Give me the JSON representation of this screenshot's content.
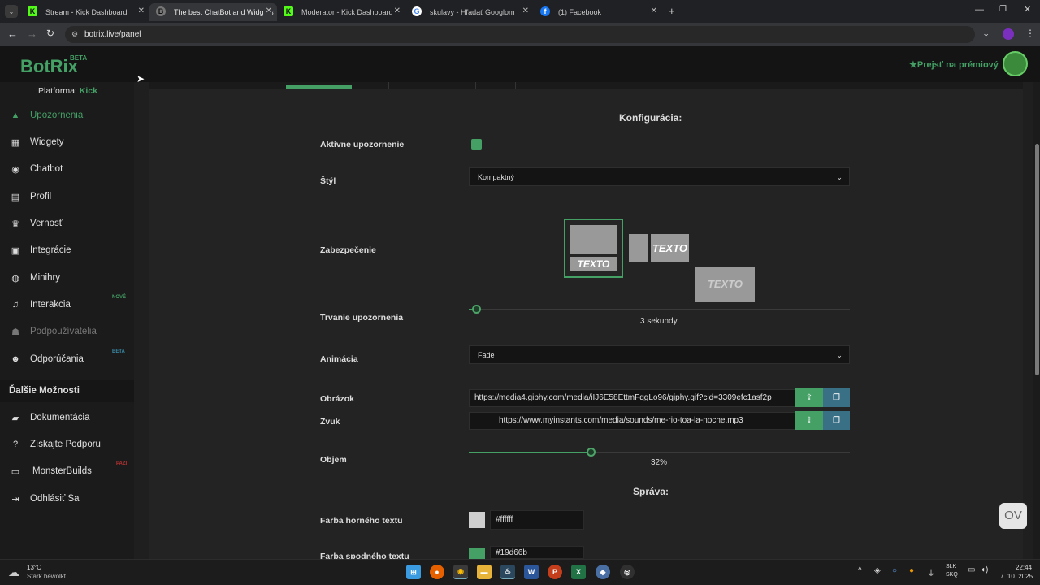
{
  "browser": {
    "tabs": [
      {
        "title": "Stream - Kick Dashboard",
        "favicon": "K"
      },
      {
        "title": "The best ChatBot and Widgets",
        "favicon": "B"
      },
      {
        "title": "Moderator - Kick Dashboard",
        "favicon": "K"
      },
      {
        "title": "skulavy - Hľadať Googlom",
        "favicon": "G"
      },
      {
        "title": "(1) Facebook",
        "favicon": "f"
      }
    ],
    "url": "botrix.live/panel"
  },
  "app": {
    "logo": "BotRix",
    "logo_badge": "BETA",
    "platform_label": "Platforma:",
    "platform_value": "Kick",
    "premium_label": "Prejsť na prémiový",
    "accent_color": "#44a065"
  },
  "sidebar": {
    "items": [
      {
        "label": "Upozornenia",
        "icon": "warning-icon"
      },
      {
        "label": "Widgety",
        "icon": "grid-icon"
      },
      {
        "label": "Chatbot",
        "icon": "robot-icon"
      },
      {
        "label": "Profil",
        "icon": "id-card-icon"
      },
      {
        "label": "Vernosť",
        "icon": "trophy-icon"
      },
      {
        "label": "Integrácie",
        "icon": "plug-icon"
      },
      {
        "label": "Minihry",
        "icon": "gamepad-icon"
      },
      {
        "label": "Interakcia",
        "icon": "music-icon",
        "badge": "NOVÉ"
      },
      {
        "label": "Podpoužívatelia",
        "icon": "users-icon"
      },
      {
        "label": "Odporúčania",
        "icon": "group-icon",
        "badge": "BETA"
      }
    ],
    "more_header": "Ďalšie Možnosti",
    "more_items": [
      {
        "label": "Dokumentácia",
        "icon": "book-icon"
      },
      {
        "label": "Získajte Podporu",
        "icon": "help-icon"
      },
      {
        "label": "MonsterBuilds",
        "icon": "laptop-icon",
        "badge": "PAZI"
      },
      {
        "label": "Odhlásiť Sa",
        "icon": "logout-icon"
      }
    ]
  },
  "config": {
    "title": "Konfigurácia:",
    "active_label": "Aktívne upozornenie",
    "style_label": "Štýl",
    "style_value": "Kompaktný",
    "security_label": "Zabezpečenie",
    "style_preview_text": "TEXTO",
    "duration_label": "Trvanie upozornenia",
    "duration_value": "3 sekundy",
    "duration_fraction": 0.02,
    "animation_label": "Animácia",
    "animation_value": "Fade",
    "image_label": "Obrázok",
    "image_url": "https://media4.giphy.com/media/iIJ6E58EttmFqgLo96/giphy.gif?cid=3309efc1asf2p",
    "sound_label": "Zvuk",
    "sound_url": "https://www.myinstants.com/media/sounds/me-rio-toa-la-noche.mp3",
    "volume_label": "Objem",
    "volume_value": "32%",
    "volume_fraction": 0.32,
    "message_title": "Správa:",
    "top_text_color_label": "Farba horného textu",
    "top_text_color": "#ffffff",
    "bottom_text_color_label": "Farba spodného textu",
    "bottom_text_color": "#19d66b",
    "bottom_swatch_color": "#44a065"
  },
  "taskbar": {
    "weather_temp": "13°C",
    "weather_desc": "Stark bewölkt",
    "lang_top": "SLK",
    "lang_bottom": "SKQ",
    "time": "22:44",
    "date": "7. 10. 2025"
  }
}
